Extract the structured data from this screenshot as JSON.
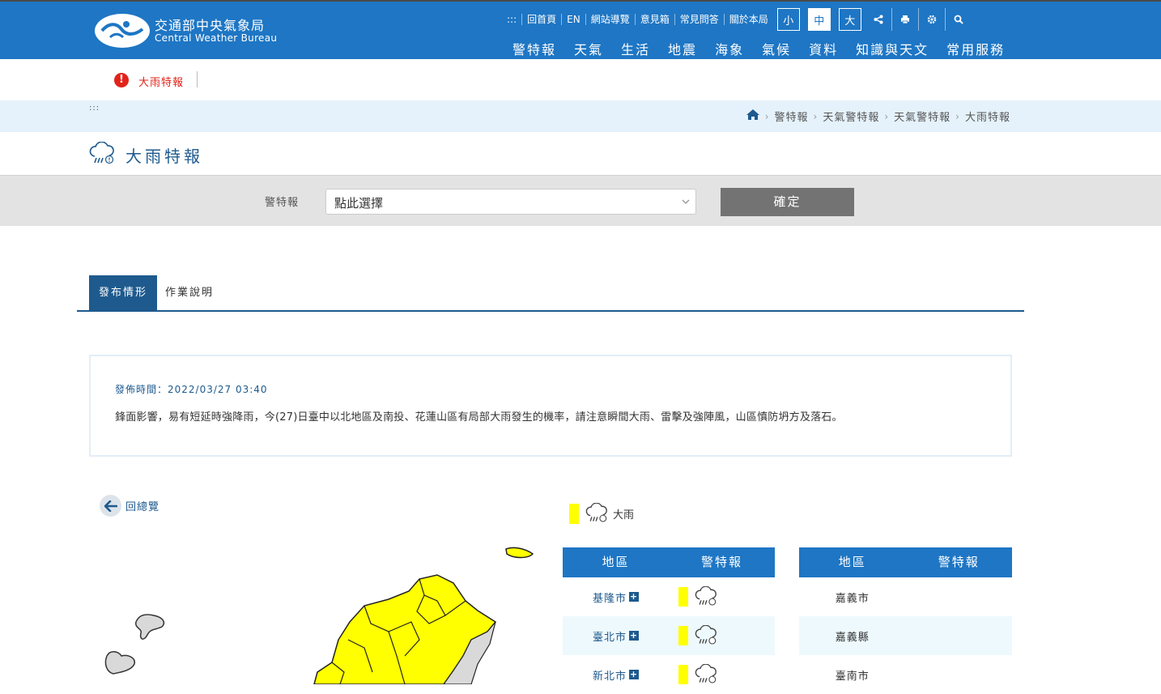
{
  "header": {
    "org_zh": "交通部中央氣象局",
    "org_en": "Central Weather Bureau",
    "util": {
      "dots": ":::",
      "home": "回首頁",
      "en": "EN",
      "sitemap": "網站導覽",
      "mailbox": "意見箱",
      "faq": "常見問答",
      "about": "關於本局"
    },
    "font_sizes": [
      "小",
      "中",
      "大"
    ],
    "icons": [
      "share-icon",
      "print-icon",
      "gear-icon",
      "search-icon"
    ],
    "nav": [
      "警特報",
      "天氣",
      "生活",
      "地震",
      "海象",
      "氣候",
      "資料",
      "知識與天文",
      "常用服務"
    ]
  },
  "alert": {
    "text": "大雨特報"
  },
  "breadcrumb": {
    "dots": ":::",
    "items": [
      "警特報",
      "天氣警特報",
      "天氣警特報",
      "大雨特報"
    ]
  },
  "page": {
    "title": "大雨特報"
  },
  "select": {
    "label": "警特報",
    "value": "點此選擇",
    "confirm": "確定"
  },
  "tabs": {
    "active": "發布情形",
    "other": "作業說明"
  },
  "info": {
    "time": "發佈時間：2022/03/27 03:40",
    "text": "鋒面影響，易有短延時強降雨，今(27)日臺中以北地區及南投、花蓮山區有局部大雨發生的機率，請注意瞬間大雨、雷擊及強陣風，山區慎防坍方及落石。"
  },
  "back": {
    "label": "回總覽"
  },
  "legend": {
    "label": "大雨",
    "color": "#ffff00"
  },
  "table_left": {
    "headers": [
      "地區",
      "警特報"
    ],
    "rows": [
      {
        "region": "基隆市",
        "warn": true
      },
      {
        "region": "臺北市",
        "warn": true
      },
      {
        "region": "新北市",
        "warn": true
      }
    ]
  },
  "table_right": {
    "headers": [
      "地區",
      "警特報"
    ],
    "rows": [
      {
        "region": "嘉義市",
        "warn": false
      },
      {
        "region": "嘉義縣",
        "warn": false
      },
      {
        "region": "臺南市",
        "warn": false
      }
    ]
  },
  "colors": {
    "brand": "#1e76c4",
    "alert": "#e2231a",
    "warning_yellow": "#ffff00"
  }
}
